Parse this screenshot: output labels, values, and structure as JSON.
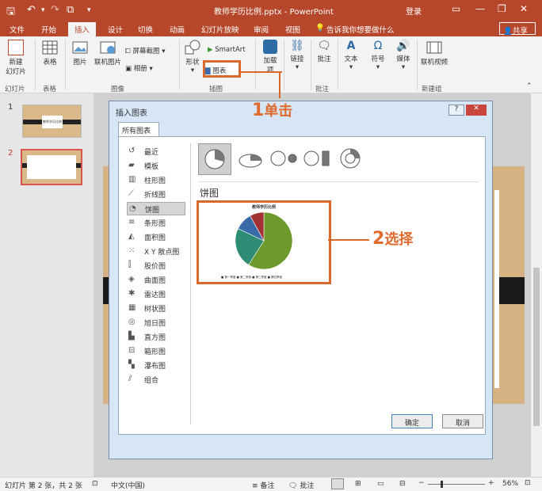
{
  "titlebar": {
    "title": "教师学历比例.pptx - PowerPoint",
    "login": "登录",
    "save_icon": "save-icon",
    "undo_icon": "undo-icon",
    "redo_icon": "redo-icon",
    "present_icon": "present-icon",
    "minimize": "—",
    "restore": "❐",
    "close": "✕",
    "restore_ribbon": "▭"
  },
  "tabs": [
    "文件",
    "开始",
    "插入",
    "设计",
    "切换",
    "动画",
    "幻灯片放映",
    "审阅",
    "视图"
  ],
  "tell_me": "告诉我你想要做什么",
  "share": "共享",
  "ribbon": {
    "new_slide": "新建\n幻灯片",
    "new_slide_l1": "新建",
    "new_slide_l2": "幻灯片",
    "table": "表格",
    "picture": "图片",
    "online_picture": "联机图片",
    "screenshot": "屏幕截图",
    "album": "相册",
    "shapes": "形状",
    "smartart": "SmartArt",
    "chart": "图表",
    "addins": "加载",
    "addins2": "项",
    "links": "链接",
    "comment": "批注",
    "text": "文本",
    "symbols": "符号",
    "media": "媒体",
    "online_video": "联机视频",
    "groups": {
      "slides": "幻灯片",
      "tables": "表格",
      "images": "图像",
      "illustrations": "插图",
      "comments": "批注",
      "new_group": "新建组"
    }
  },
  "thumbnails": [
    {
      "num": "1",
      "text": "教师学历比例"
    },
    {
      "num": "2",
      "text": ""
    }
  ],
  "dialog": {
    "title": "插入图表",
    "help": "?",
    "close": "✕",
    "tab": "所有图表",
    "categories": [
      "最近",
      "模板",
      "柱形图",
      "折线图",
      "饼图",
      "条形图",
      "面积图",
      "X Y 散点图",
      "股价图",
      "曲面图",
      "雷达图",
      "树状图",
      "旭日图",
      "直方图",
      "箱形图",
      "瀑布图",
      "组合"
    ],
    "selected_category": "饼图",
    "section_title": "饼图",
    "preview_title": "教师学历比例",
    "preview_legend": [
      "■ 第一季度",
      "■ 第二季度",
      "■ 第三季度",
      "■ 第四季度"
    ],
    "ok": "确定",
    "cancel": "取消"
  },
  "chart_data": {
    "type": "pie",
    "title": "教师学历比例",
    "categories": [
      "第一季度",
      "第二季度",
      "第三季度",
      "第四季度"
    ],
    "values": [
      59,
      23,
      10,
      8
    ],
    "colors": [
      "#6d9a2c",
      "#2e8b74",
      "#3a6aa8",
      "#a33333"
    ]
  },
  "callouts": {
    "step1_num": "1",
    "step1_text": "单击",
    "step2_num": "2",
    "step2_text": "选择"
  },
  "status": {
    "slide_info": "幻灯片 第 2 张，共 2 张",
    "language": "中文(中国)",
    "notes": "备注",
    "comments": "批注",
    "zoom": "56%",
    "zoom_minus": "−",
    "zoom_plus": "+"
  },
  "colors": {
    "accent": "#b7472a",
    "callout": "#e06b2e"
  }
}
